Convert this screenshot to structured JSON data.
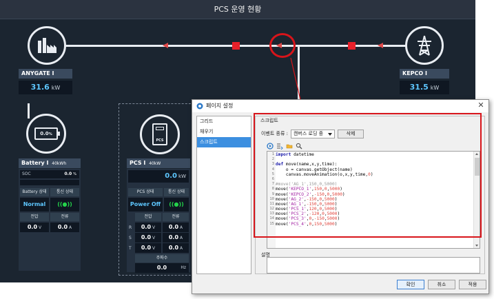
{
  "scada": {
    "title": "PCS 운영 현황",
    "anygate": {
      "label": "ANYGATE I",
      "value": "31.6",
      "unit": "kW"
    },
    "kepco": {
      "label": "KEPCO I",
      "value": "31.5",
      "unit": "kW"
    },
    "battery": {
      "icon_value": "0.0",
      "icon_unit": "%",
      "label": "Battery I",
      "capacity": "40kWh",
      "soc_label": "SOC",
      "soc_value": "0.0",
      "soc_unit": "%",
      "status_header": "Battery 상태",
      "comm_header": "통신 상태",
      "status": "Normal",
      "voltage_header": "전압",
      "current_header": "전류",
      "voltage": "0.0",
      "voltage_unit": "V",
      "current": "0.0",
      "current_unit": "A"
    },
    "pcs": {
      "icon_label": "PCS",
      "label": "PCS I",
      "capacity": "40kW",
      "power": "0.0",
      "power_unit": "kW",
      "status_header": "PCS 상태",
      "comm_header": "통신 상태",
      "status": "Power Off",
      "voltage_header": "전압",
      "current_header": "전류",
      "rows": [
        {
          "phase": "R",
          "voltage": "0.0",
          "current": "0.0"
        },
        {
          "phase": "S",
          "voltage": "0.0",
          "current": "0.0"
        },
        {
          "phase": "T",
          "voltage": "0.0",
          "current": "0.0"
        }
      ],
      "v_unit": "V",
      "a_unit": "A",
      "freq_header": "주파수",
      "freq": "0.0",
      "freq_unit": "Hz"
    }
  },
  "dialog": {
    "title": "페이지 설정",
    "close_label": "✕",
    "tree": [
      {
        "label": "그리드"
      },
      {
        "label": "채우기"
      },
      {
        "label": "스크립트"
      }
    ],
    "section_title": "스크립트",
    "event_label": "이벤트 종류 :",
    "event_value": "캔버스 로딩 중",
    "delete_label": "삭제",
    "description_label": "설명",
    "ok_label": "확인",
    "cancel_label": "취소",
    "apply_label": "적용",
    "code": [
      "import datetime",
      "",
      "def move(name,x,y,time):",
      "    o = canvas.getObject(name)",
      "    canvas.moveAnimation(o,x,y,time,0)",
      "",
      "#move('AG_1',150,0,5000)",
      "move('KEPCO_1',150,0,5000)",
      "move('KEPCO_2',-150,0,5000)",
      "move('AG_2',-150,0,5000)",
      "move('AG_1',-150,0,5000)",
      "move('PCS_1',120,0,5000)",
      "move('PCS_2',-120,0,5000)",
      "move('PCS_3',0,-150,5000)",
      "move('PCS_4',0,150,5000)"
    ]
  },
  "colors": {
    "background": "#1b2530",
    "value_text": "#5ec7ff",
    "status_green": "#24d24b",
    "annotation_red": "#d8141a",
    "selected_blue": "#3c8fe0"
  }
}
